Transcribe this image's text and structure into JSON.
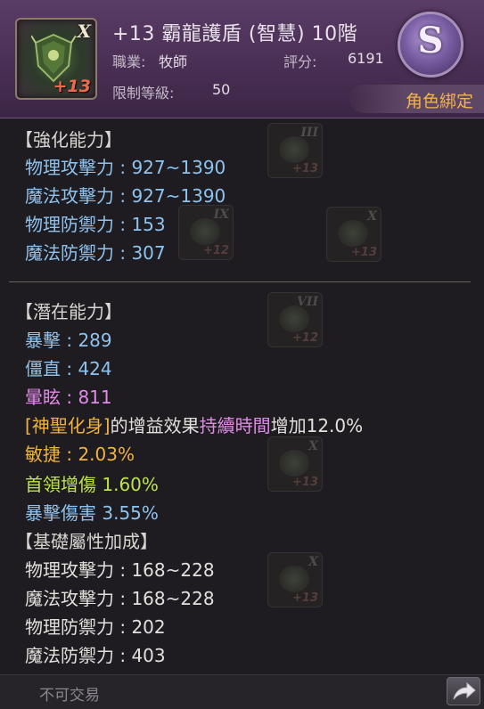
{
  "item": {
    "name": "+13 霸龍護盾 (智慧) 10階",
    "tier_mark": "X",
    "enhance_level": "+13",
    "job_label": "職業:",
    "job_value": "牧師",
    "score_label": "評分:",
    "score_value": "6191",
    "req_level_label": "限制等級:",
    "req_level_value": "50",
    "grade": "S",
    "bind_status": "角色綁定"
  },
  "sections": {
    "enhance": {
      "title": "【強化能力】",
      "stats": [
        "物理攻擊力 : 927~1390",
        "魔法攻擊力 : 927~1390",
        "物理防禦力 : 153",
        "魔法防禦力 : 307"
      ]
    },
    "potential": {
      "title": "【潛在能力】",
      "stats": [
        "暴擊 : 289",
        "僵直 : 424",
        "暈眩 : 811"
      ],
      "skill_effect": {
        "skill": "[神聖化身]",
        "mid": "的增益效果",
        "attr": "持續時間",
        "tail": "增加12.0%"
      },
      "extra": [
        "敏捷 : 2.03%",
        "首領增傷 1.60%",
        "暴擊傷害 3.55%"
      ]
    },
    "base": {
      "title": "【基礎屬性加成】",
      "stats": [
        "物理攻擊力 : 168~228",
        "魔法攻擊力 : 168~228",
        "物理防禦力 : 202",
        "魔法防禦力 : 403"
      ]
    }
  },
  "footer": {
    "trade_status": "不可交易"
  },
  "colors": {
    "enhance_stat": "#8ec3ef",
    "base_stat": "#e3e0dc",
    "stun": "#e08be6",
    "skill_name": "#f0b240",
    "boss_damage": "#bde34a",
    "bind_status": "#f2b34a"
  },
  "icons": {
    "share": "share-arrow-icon"
  }
}
